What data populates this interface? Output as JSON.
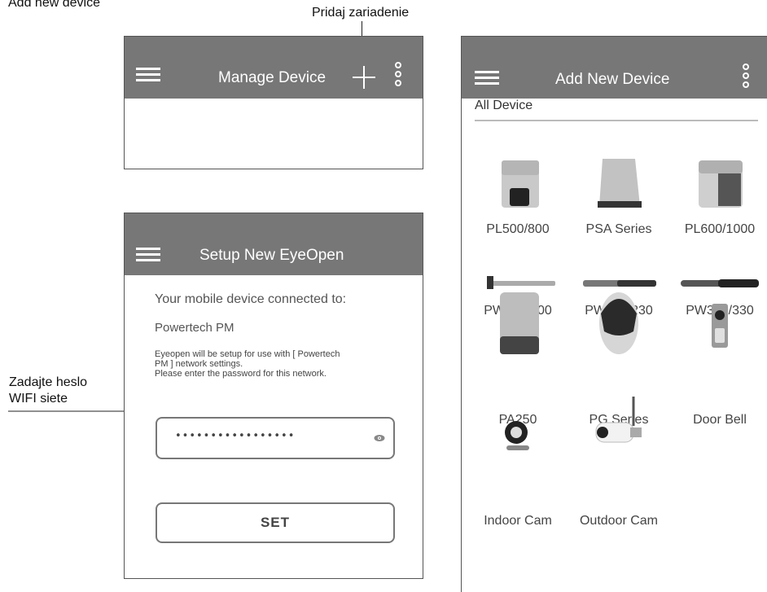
{
  "annotations": {
    "top_left": "Add new device",
    "add_button_callout": "Pridaj zariadenie",
    "password_callout_line1": "Zadajte heslo",
    "password_callout_line2": "WIFI siete"
  },
  "manage_screen": {
    "title": "Manage Device",
    "add_icon": "plus-icon",
    "menu_icon": "hamburger-icon",
    "more_icon": "kebab-icon"
  },
  "setup_screen": {
    "title": "Setup New EyeOpen",
    "connected_label": "Your mobile device connected to:",
    "network_name": "Powertech PM",
    "info_line1": "Eyeopen will be setup for use with [ Powertech",
    "info_line2": "PM ] network settings.",
    "info_line3": "Please enter the password for this network.",
    "password_value": "•••••••••••••••••",
    "show_password_icon": "eye-icon",
    "set_button": "SET"
  },
  "add_screen": {
    "title": "Add New Device",
    "tab_label": "All Device",
    "devices": [
      {
        "label": "PL500/800",
        "icon": "gate-motor-icon"
      },
      {
        "label": "PSA Series",
        "icon": "gate-motor-icon"
      },
      {
        "label": "PL600/1000",
        "icon": "gate-motor-icon"
      },
      {
        "label": "PW150/200",
        "icon": "swing-arm-icon"
      },
      {
        "label": "PW220/230",
        "icon": "swing-arm-icon"
      },
      {
        "label": "PW320/330",
        "icon": "swing-arm-icon"
      },
      {
        "label": "PA250",
        "icon": "gate-motor-icon"
      },
      {
        "label": "PG Series",
        "icon": "garage-opener-icon"
      },
      {
        "label": "Door Bell",
        "icon": "doorbell-icon"
      },
      {
        "label": "Indoor Cam",
        "icon": "indoor-camera-icon"
      },
      {
        "label": "Outdoor Cam",
        "icon": "outdoor-camera-icon"
      }
    ]
  },
  "colors": {
    "appbar": "#777777",
    "border": "#555555",
    "watermark": "#ececec"
  }
}
